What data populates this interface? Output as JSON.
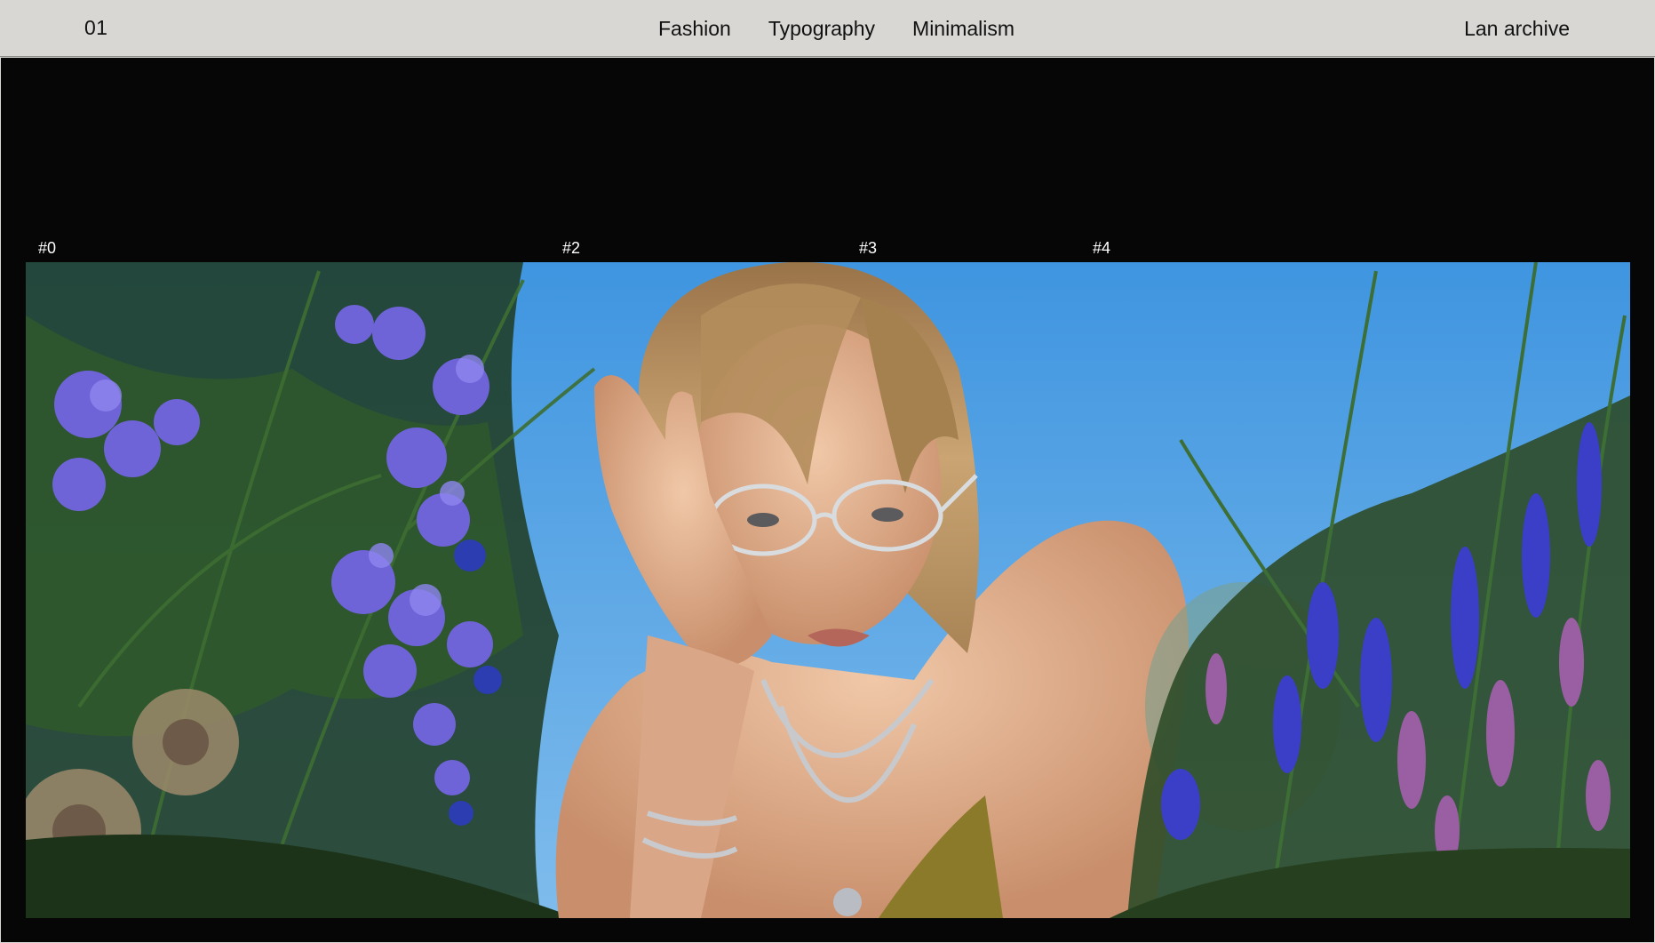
{
  "header": {
    "index": "01",
    "nav": [
      "Fashion",
      "Typography",
      "Minimalism"
    ],
    "archive_label": "Lan archive"
  },
  "frames": {
    "labels": [
      "#0",
      "#2",
      "#3",
      "#4"
    ]
  },
  "colors": {
    "header_bg": "#d8d7d4",
    "stage_bg": "#060607",
    "sky": "#4f9ee3",
    "text_dark": "#111111",
    "text_light": "#ffffff"
  }
}
